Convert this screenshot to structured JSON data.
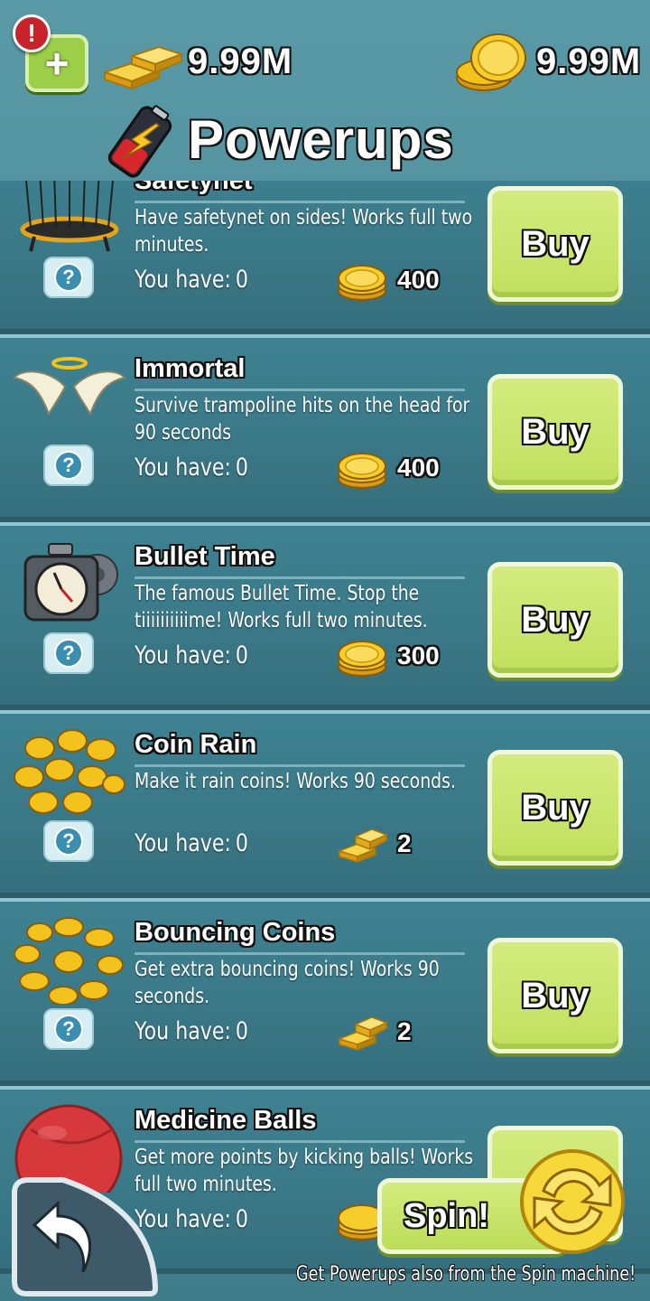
{
  "header": {
    "gold_amount": "9.99M",
    "coin_amount": "9.99M",
    "title": "Powerups",
    "alert_symbol": "!",
    "plus_symbol": "+"
  },
  "items": [
    {
      "name": "Safetynet",
      "description": "Have safetynet on sides! Works full two minutes.",
      "have_label": "You have:",
      "have_count": "0",
      "price": "400",
      "currency": "coin",
      "icon": "trampoline-net-icon",
      "buy_label": "Buy"
    },
    {
      "name": "Immortal",
      "description": "Survive trampoline hits on the head for 90 seconds",
      "have_label": "You have:",
      "have_count": "0",
      "price": "400",
      "currency": "coin",
      "icon": "angel-wings-icon",
      "buy_label": "Buy"
    },
    {
      "name": "Bullet Time",
      "description": "The famous Bullet Time. Stop the tiiiiiiiiiime! Works full two minutes.",
      "have_label": "You have:",
      "have_count": "0",
      "price": "300",
      "currency": "coin",
      "icon": "stopwatch-icon",
      "buy_label": "Buy"
    },
    {
      "name": "Coin Rain",
      "description": "Make it rain coins! Works 90 seconds.",
      "have_label": "You have:",
      "have_count": "0",
      "price": "2",
      "currency": "gold",
      "icon": "coin-pile-icon",
      "buy_label": "Buy"
    },
    {
      "name": "Bouncing Coins",
      "description": "Get extra bouncing coins! Works 90 seconds.",
      "have_label": "You have:",
      "have_count": "0",
      "price": "2",
      "currency": "gold",
      "icon": "coin-ring-icon",
      "buy_label": "Buy"
    },
    {
      "name": "Medicine Balls",
      "description": "Get more points by kicking balls! Works full two minutes.",
      "have_label": "You have:",
      "have_count": "0",
      "price": "",
      "currency": "coin",
      "icon": "medicine-ball-icon",
      "buy_label": ""
    }
  ],
  "help_label": "?",
  "spin": {
    "label": "Spin!"
  },
  "footer_note": "Get Powerups also from the Spin machine!",
  "colors": {
    "background": "#4a8a98",
    "button_green": "#c6e266",
    "gold": "#f3c21c",
    "alert_red": "#c8222a"
  }
}
